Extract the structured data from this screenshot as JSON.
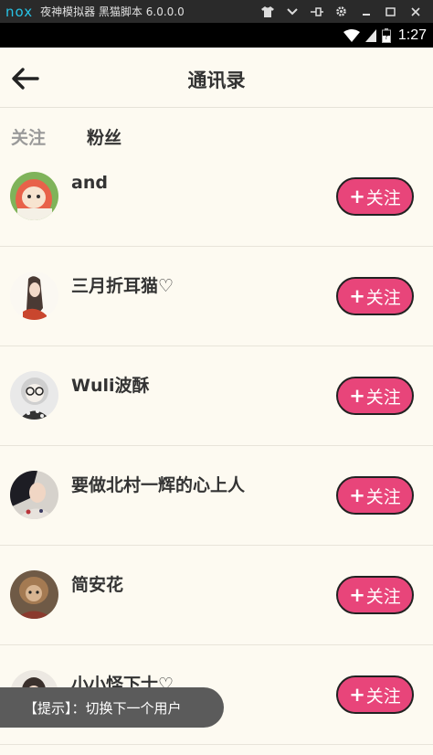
{
  "emulator": {
    "logo": "nox",
    "title": "夜神模拟器 黑猫脚本 6.0.0.0",
    "controls": [
      "shirt-icon",
      "chevron-down-icon",
      "pin-icon",
      "gear-icon",
      "minimize-icon",
      "maximize-icon",
      "close-icon"
    ]
  },
  "status_bar": {
    "time": "1:27",
    "battery_level": "0.45"
  },
  "header": {
    "title": "通讯录"
  },
  "tabs": [
    {
      "label": "关注",
      "active": false
    },
    {
      "label": "粉丝",
      "active": true
    }
  ],
  "users": [
    {
      "name": "and",
      "follow_label": "关注"
    },
    {
      "name": "三月折耳猫♡",
      "follow_label": "关注"
    },
    {
      "name": "Wuli波酥",
      "follow_label": "关注"
    },
    {
      "name": "要做北村一辉的心上人",
      "follow_label": "关注"
    },
    {
      "name": "简安花",
      "follow_label": "关注"
    },
    {
      "name": "小小怪下士♡",
      "follow_label": "关注"
    }
  ],
  "follow_plus": "+",
  "toast": {
    "text": "【提示】：切换下一个用户"
  },
  "colors": {
    "accent": "#e8457a",
    "background": "#fdfaf1",
    "text": "#333333"
  }
}
